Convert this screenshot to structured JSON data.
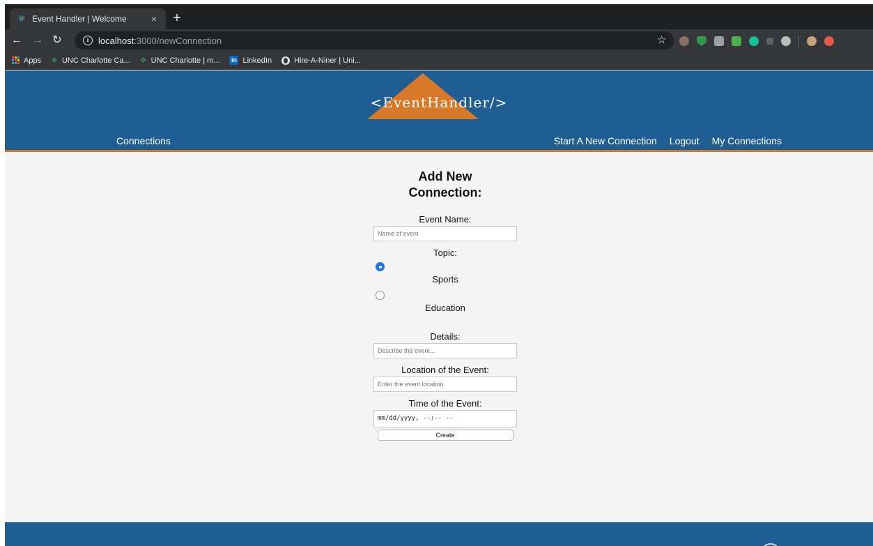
{
  "browser": {
    "tab_title": "Event Handler | Welcome",
    "url_host": "localhost",
    "url_path": ":3000/newConnection",
    "bookmarks": [
      {
        "label": "Apps",
        "icon": "apps-grid-icon"
      },
      {
        "label": "UNC Charlotte Ca...",
        "icon": "leaf-icon"
      },
      {
        "label": "UNC Charlotte | m...",
        "icon": "leaf-icon"
      },
      {
        "label": "LinkedIn",
        "icon": "linkedin-icon"
      },
      {
        "label": "Hire-A-Niner | Uni...",
        "icon": "globe-icon"
      }
    ]
  },
  "header": {
    "logo": "<EventHandler/>",
    "nav_left": "Connections",
    "nav_right": [
      "Start A New Connection",
      "Logout",
      "My Connections"
    ]
  },
  "form": {
    "title": "Add New Connection:",
    "event_name_label": "Event Name:",
    "event_name_placeholder": "Name of event",
    "topic_label": "Topic:",
    "topics": [
      {
        "label": "Sports",
        "checked": true
      },
      {
        "label": "Education",
        "checked": false
      }
    ],
    "details_label": "Details:",
    "details_placeholder": "Describe the event...",
    "location_label": "Location of the Event:",
    "location_placeholder": "Enter the event location",
    "time_label": "Time of the Event:",
    "time_value": "mm/dd/yyyy, --:-- --",
    "create_label": "Create"
  },
  "colors": {
    "header_bg": "#1f5e92",
    "accent": "#d8792a",
    "radio_checked": "#1a73e8"
  }
}
